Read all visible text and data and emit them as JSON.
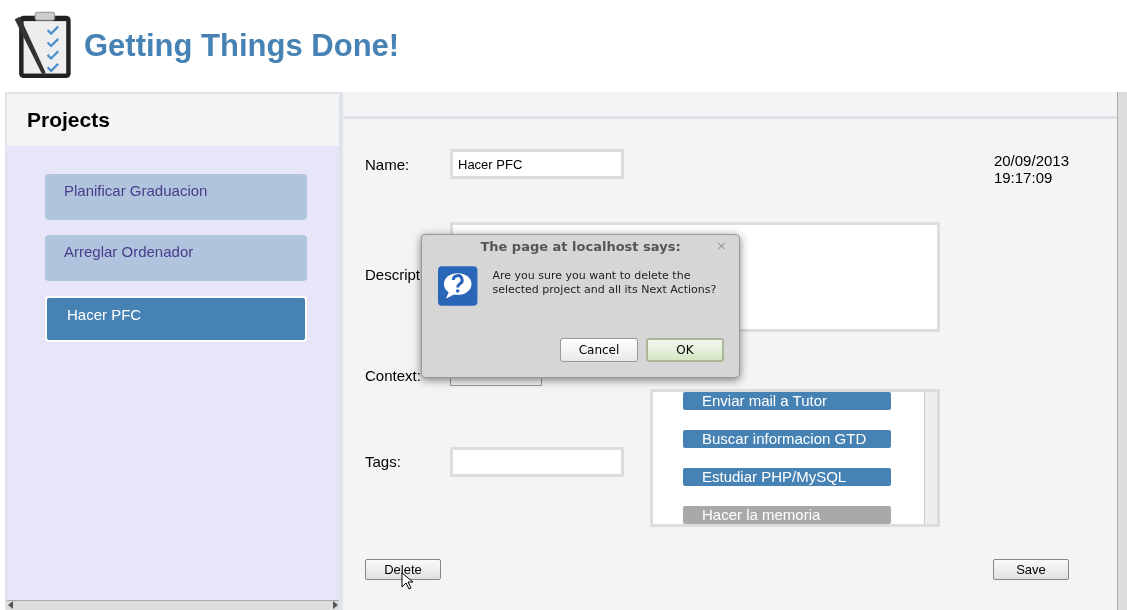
{
  "app": {
    "title": "Getting Things Done!"
  },
  "sidebar": {
    "title": "Projects",
    "projects": [
      {
        "label": "Planificar Graduacion",
        "selected": false
      },
      {
        "label": "Arreglar Ordenador",
        "selected": false
      },
      {
        "label": "Hacer PFC",
        "selected": true
      }
    ]
  },
  "form": {
    "name_label": "Name:",
    "name_value": "Hacer PFC",
    "timestamp": [
      "20/09/2013",
      "19:17:09"
    ],
    "description_label": "Descript",
    "context_label": "Context:",
    "tags_label": "Tags:",
    "next_actions": [
      {
        "label": "Enviar mail a Tutor",
        "done": false
      },
      {
        "label": "Buscar informacion GTD",
        "done": false
      },
      {
        "label": "Estudiar PHP/MySQL",
        "done": false
      },
      {
        "label": "Hacer la memoria",
        "done": true
      }
    ],
    "buttons": {
      "delete": "Delete",
      "save": "Save"
    }
  },
  "dialog": {
    "title": "The page at localhost says:",
    "close": "×",
    "message": "Are you sure you want to delete the selected project and all its Next Actions?",
    "buttons": [
      {
        "label": "Cancel",
        "default": false
      },
      {
        "label": "OK",
        "default": true
      }
    ]
  }
}
